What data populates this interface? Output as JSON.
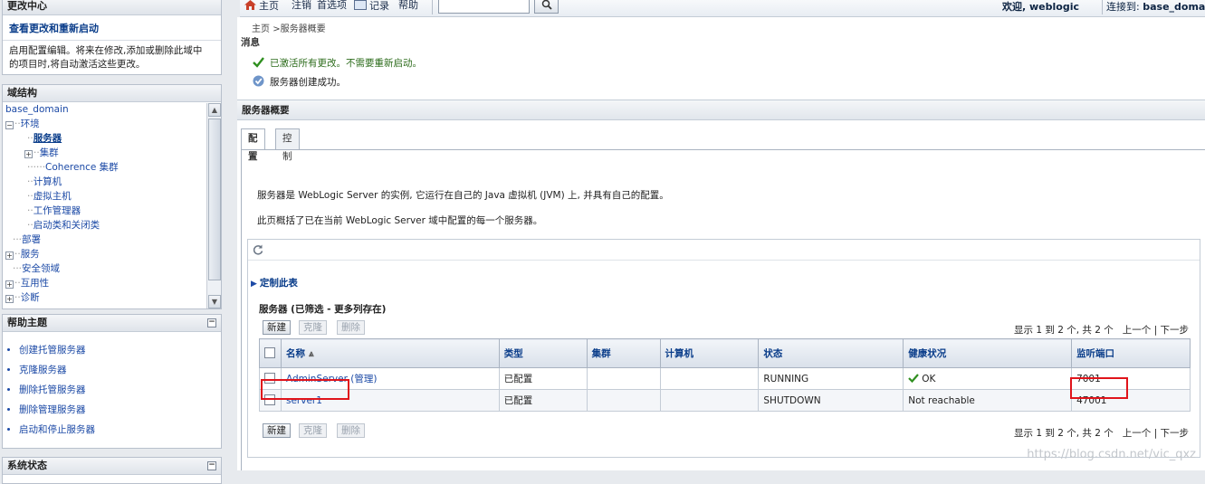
{
  "left": {
    "change_center": {
      "title": "更改中心",
      "view_link": "查看更改和重新启动",
      "text_line1": "启用配置编辑。将来在修改,添加或删除此域中",
      "text_line2": "的项目时,将自动激活这些更改。"
    },
    "domain_structure": {
      "title": "域结构",
      "items": [
        {
          "label": "base_domain"
        },
        {
          "label": "环境"
        },
        {
          "label": "服务器"
        },
        {
          "label": "集群"
        },
        {
          "label": "Coherence 集群"
        },
        {
          "label": "计算机"
        },
        {
          "label": "虚拟主机"
        },
        {
          "label": "工作管理器"
        },
        {
          "label": "启动类和关闭类"
        },
        {
          "label": "部署"
        },
        {
          "label": "服务"
        },
        {
          "label": "安全领域"
        },
        {
          "label": "互用性"
        },
        {
          "label": "诊断"
        }
      ]
    },
    "help_topics": {
      "title": "帮助主题",
      "toggle": "⊟",
      "items": [
        "创建托管服务器",
        "克隆服务器",
        "删除托管服务器",
        "删除管理服务器",
        "启动和停止服务器"
      ]
    },
    "system_status": {
      "title": "系统状态",
      "toggle": "⊟"
    }
  },
  "topbar": {
    "home": "主页",
    "logout": "注销",
    "preferences": "首选项",
    "record": "记录",
    "help": "帮助",
    "search_value": "",
    "welcome": "欢迎, weblogic",
    "connected_label": "连接到:",
    "connected_domain": "base_domain"
  },
  "main": {
    "breadcrumb_home": "主页",
    "breadcrumb_sep": ">",
    "breadcrumb_current": "服务器概要",
    "messages_label": "消息",
    "msg_activated": "已激活所有更改。不需要重新启动。",
    "msg_created": "服务器创建成功。",
    "panel_title": "服务器概要",
    "tabs": [
      "配置",
      "控制"
    ],
    "desc1": "服务器是 WebLogic Server 的实例, 它运行在自己的 Java 虚拟机 (JVM) 上, 并具有自己的配置。",
    "desc2": "此页概括了已在当前 WebLogic Server 域中配置的每一个服务器。",
    "customize": "定制此表",
    "table_title": "服务器 (已筛选 - 更多列存在)",
    "buttons": {
      "new": "新建",
      "clone": "克隆",
      "delete": "删除"
    },
    "pager": {
      "showing": "显示 1 到 2 个, 共 2 个",
      "prev": "上一个",
      "sep": "|",
      "next": "下一步"
    },
    "columns": [
      "名称",
      "类型",
      "集群",
      "计算机",
      "状态",
      "健康状况",
      "监听端口"
    ],
    "rows": [
      {
        "name": "AdminServer (管理)",
        "type": "已配置",
        "cluster": "",
        "machine": "",
        "state": "RUNNING",
        "health": "OK",
        "port": "7001"
      },
      {
        "name": "server1",
        "type": "已配置",
        "cluster": "",
        "machine": "",
        "state": "SHUTDOWN",
        "health": "Not reachable",
        "port": "47001"
      }
    ]
  },
  "watermark": "https://blog.csdn.net/vic_qxz",
  "colors": {
    "ok": "#2f8f1f",
    "highlight": "#e0141b",
    "link": "#1c4aa6"
  }
}
